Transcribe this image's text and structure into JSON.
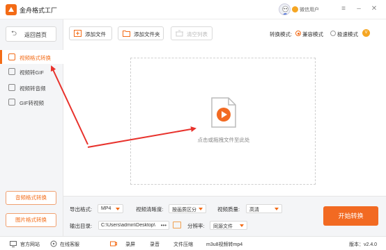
{
  "app": {
    "title": "金舟格式工厂",
    "user_name": "微信用户",
    "window_controls": [
      "menu-icon",
      "minimize-icon",
      "close-icon"
    ]
  },
  "sidebar": {
    "back_label": "返回首页",
    "items": [
      {
        "label": "视频格式转换",
        "icon": "video-convert-icon",
        "active": true
      },
      {
        "label": "视频转GIF",
        "icon": "gif-icon",
        "active": false
      },
      {
        "label": "视频转音频",
        "icon": "audio-icon",
        "active": false
      },
      {
        "label": "GIF转视频",
        "icon": "gif-video-icon",
        "active": false
      }
    ],
    "bottom_buttons": [
      "音频格式转换",
      "图片格式转换"
    ]
  },
  "toolbar": {
    "add_file": "添加文件",
    "add_folder": "添加文件夹",
    "clear_list": "清空列表",
    "mode_label": "转换模式:",
    "modes": [
      {
        "label": "兼容模式",
        "selected": true
      },
      {
        "label": "极速模式",
        "selected": false
      }
    ]
  },
  "dropzone": {
    "hint": "点击或拖拽文件至此处"
  },
  "settings": {
    "output_format_label": "导出格式:",
    "output_format": "MP4",
    "clarity_label": "视频清晰度:",
    "clarity": "按画质区分",
    "quality_label": "视频质量:",
    "quality": "高清",
    "output_dir_label": "输出目录:",
    "output_dir": "C:\\Users\\admin\\Desktop\\",
    "resolution_label": "分辨率:",
    "resolution": "同源文件",
    "start_button": "开始转换"
  },
  "statusbar": {
    "website": "官方网站",
    "support": "在线客服",
    "tools": [
      "录屏",
      "录音",
      "文件压缩",
      "m3u8视频转mp4"
    ],
    "version": "版本：v2.4.0"
  },
  "colors": {
    "accent": "#f36b16",
    "annotation_arrow": "#e8322c"
  }
}
